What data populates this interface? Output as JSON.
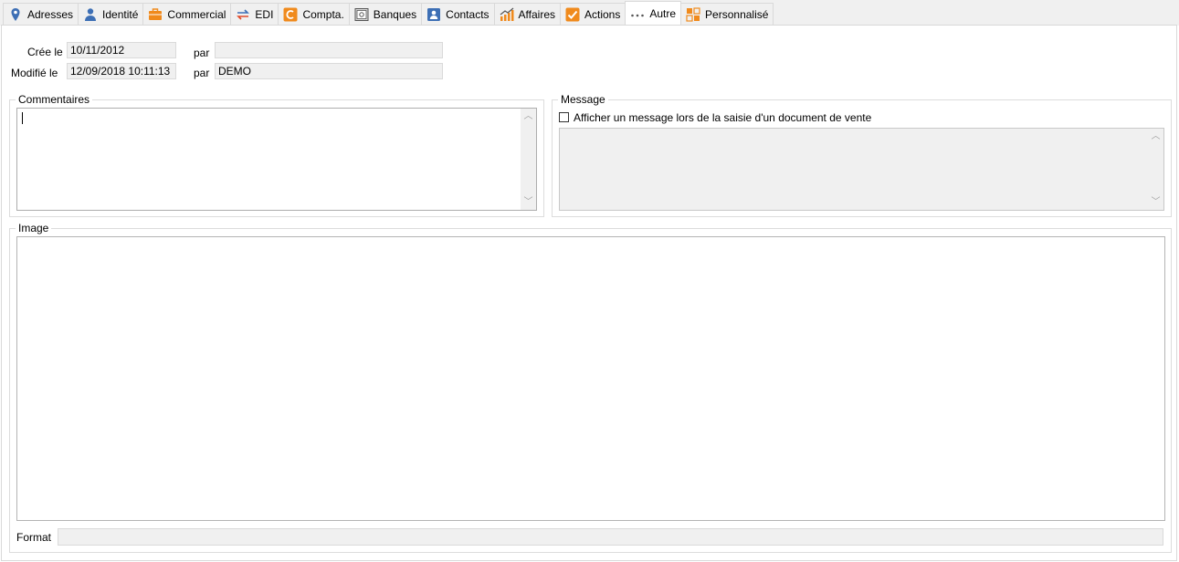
{
  "tabs": [
    {
      "label": "Adresses",
      "icon": "map-pin-icon",
      "active": false
    },
    {
      "label": "Identité",
      "icon": "person-icon",
      "active": false
    },
    {
      "label": "Commercial",
      "icon": "briefcase-icon",
      "active": false
    },
    {
      "label": "EDI",
      "icon": "exchange-arrows-icon",
      "active": false
    },
    {
      "label": "Compta.",
      "icon": "accounting-c-icon",
      "active": false
    },
    {
      "label": "Banques",
      "icon": "safe-icon",
      "active": false
    },
    {
      "label": "Contacts",
      "icon": "contact-card-icon",
      "active": false
    },
    {
      "label": "Affaires",
      "icon": "growth-chart-icon",
      "active": false
    },
    {
      "label": "Actions",
      "icon": "checkmark-icon",
      "active": false
    },
    {
      "label": "Autre",
      "icon": "dots-icon",
      "active": true
    },
    {
      "label": "Personnalisé",
      "icon": "custom-form-icon",
      "active": false
    }
  ],
  "meta": {
    "created_label": "Crée le",
    "created_value": "10/11/2012",
    "created_by_label": "par",
    "created_by_value": "",
    "modified_label": "Modifié le",
    "modified_value": "12/09/2018 10:11:13",
    "modified_by_label": "par",
    "modified_by_value": "DEMO"
  },
  "comments": {
    "legend": "Commentaires",
    "value": ""
  },
  "message": {
    "legend": "Message",
    "checkbox_label": "Afficher un message lors de la saisie d'un document de vente",
    "checked": false,
    "value": ""
  },
  "image": {
    "legend": "Image",
    "format_label": "Format",
    "format_value": ""
  },
  "colors": {
    "accent_orange": "#f08a1c",
    "icon_blue": "#3d6fb5",
    "border": "#d9d9d9",
    "readonly_bg": "#f0f0f0"
  }
}
